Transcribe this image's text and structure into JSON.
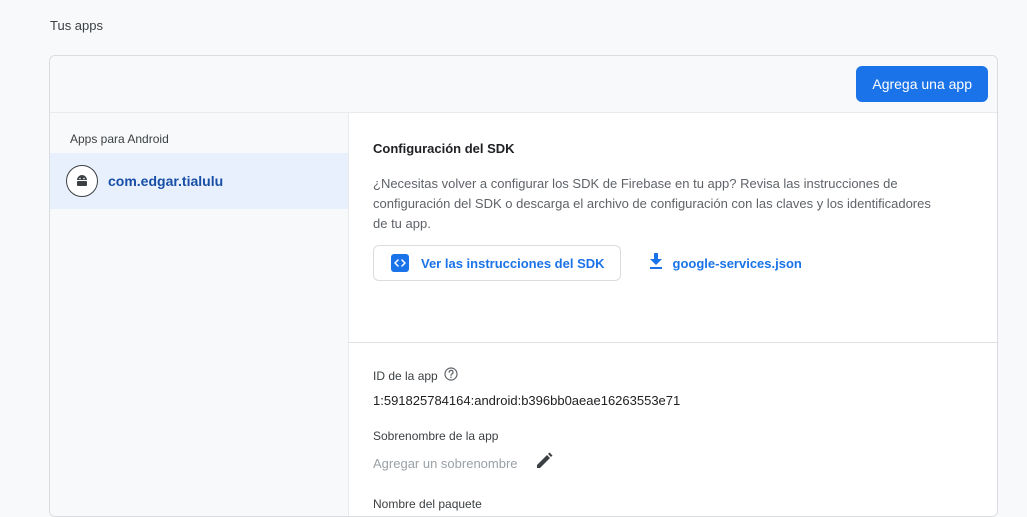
{
  "page": {
    "section_title": "Tus apps"
  },
  "header": {
    "add_app_label": "Agrega una app"
  },
  "sidebar": {
    "heading": "Apps para Android",
    "items": [
      {
        "label": "com.edgar.tialulu",
        "icon": "android-icon",
        "selected": true
      }
    ]
  },
  "sdk": {
    "title": "Configuración del SDK",
    "description": "¿Necesitas volver a configurar los SDK de Firebase en tu app? Revisa las instrucciones de configuración del SDK o descarga el archivo de configuración con las claves y los identificadores de tu app.",
    "instructions_label": "Ver las instrucciones del SDK",
    "instructions_icon": "code-icon",
    "download_label": "google-services.json",
    "download_icon": "download-icon"
  },
  "details": {
    "app_id_label": "ID de la app",
    "app_id_value": "1:591825784164:android:b396bb0aeae16263553e71",
    "nickname_label": "Sobrenombre de la app",
    "nickname_placeholder": "Agregar un sobrenombre",
    "package_label": "Nombre del paquete"
  },
  "colors": {
    "accent": "#1a73e8",
    "selected_bg": "#e8f0fe",
    "page_bg": "#f8f9fa"
  }
}
